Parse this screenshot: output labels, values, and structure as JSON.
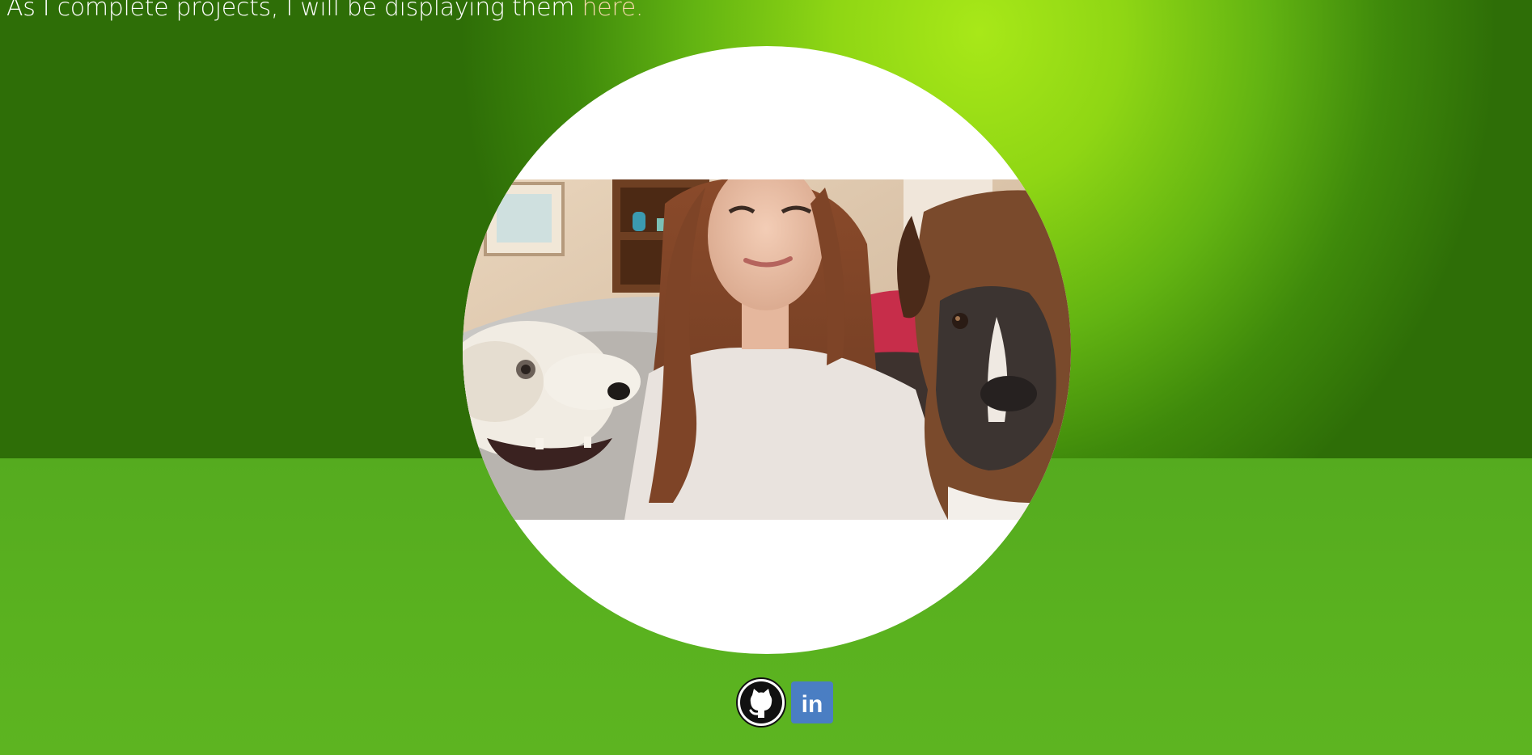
{
  "intro": {
    "text": "As I complete projects, I will be displaying them ",
    "link_label": "here."
  },
  "profile": {
    "photo_alt": "Profile photo"
  },
  "social": {
    "github_icon": "github-icon",
    "linkedin_icon": "linkedin-icon",
    "linkedin_text": "in"
  },
  "colors": {
    "accent_green": "#8fd614",
    "dark_green": "#2e6e07",
    "bottom_green": "#56ad1e",
    "link_color": "#f2d8a8",
    "linkedin_blue": "#4a7ec3"
  }
}
